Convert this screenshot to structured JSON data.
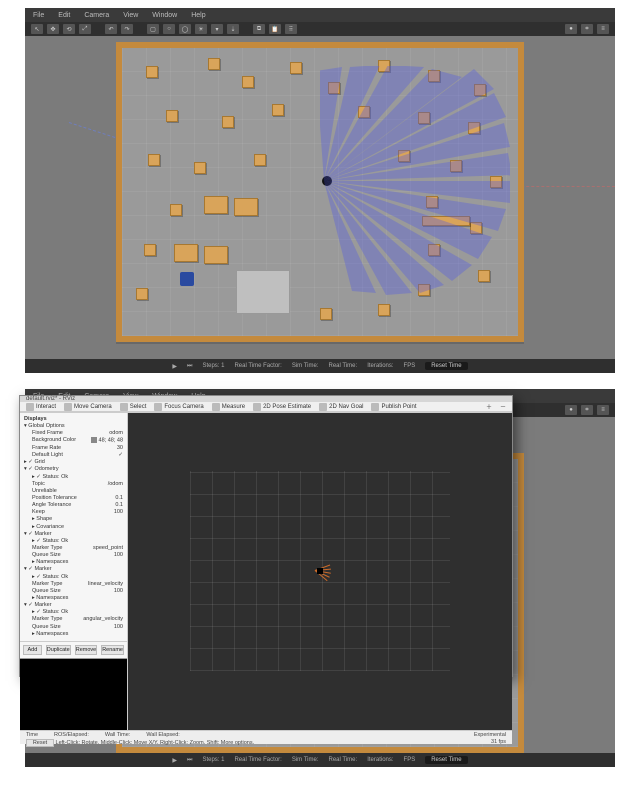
{
  "menubar": {
    "file": "File",
    "edit": "Edit",
    "camera": "Camera",
    "view": "View",
    "window": "Window",
    "help": "Help"
  },
  "bottombar": {
    "steps": "Steps: 1",
    "realtime": "Real Time Factor:",
    "simtime": "Sim Time:",
    "realtime2": "Real Time:",
    "iters": "Iterations:",
    "fps": "FPS",
    "reset": "Reset Time"
  },
  "rviz": {
    "title": "default.rviz* - RViz",
    "tools": {
      "interact": "Interact",
      "move": "Move Camera",
      "select": "Select",
      "focus": "Focus Camera",
      "measure": "Measure",
      "pose": "2D Pose Estimate",
      "nav": "2D Nav Goal",
      "publish": "Publish Point"
    },
    "displays": {
      "title": "Displays",
      "global": "Global Options",
      "fixed": "Fixed Frame",
      "fixed_v": "odom",
      "bg": "Background Color",
      "bg_v": "48; 48; 48",
      "framerate": "Frame Rate",
      "framerate_v": "30",
      "defaultlight": "Default Light",
      "grid": "Grid",
      "odom": "Odometry",
      "status": "Status: Ok",
      "topic": "Topic",
      "topic_v": "/odom",
      "unrel": "Unreliable",
      "posetol": "Position Tolerance",
      "posetol_v": "0.1",
      "angtol": "Angle Tolerance",
      "angtol_v": "0.1",
      "keep": "Keep",
      "keep_v": "100",
      "shape": "Shape",
      "cov": "Covariance",
      "marker": "Marker",
      "markertype": "Marker Type",
      "markertype_v": "speed_point",
      "queue": "Queue Size",
      "queue_v": "100",
      "ns": "Namespaces",
      "marker2": "Marker",
      "marker2t": "linear_velocity",
      "marker3t": "angular_velocity"
    },
    "buttons": {
      "add": "Add",
      "duplicate": "Duplicate",
      "remove": "Remove",
      "rename": "Rename"
    },
    "status": {
      "time": "Time",
      "rosopt": "ROS/Elapsed: ",
      "walltime": "Wall Time: ",
      "wallelapsed": "Wall Elapsed: ",
      "experimental": "Experimental",
      "reset": "Reset",
      "hint": "Left-Click: Rotate.  Middle-Click: Move X/Y.  Right-Click: Zoom.  Shift: More options.",
      "fps": "31 fps"
    }
  }
}
